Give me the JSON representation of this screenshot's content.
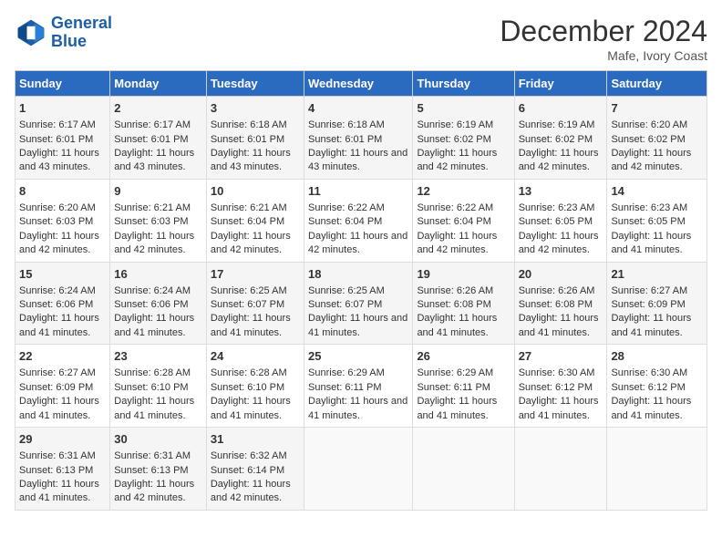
{
  "header": {
    "logo_line1": "General",
    "logo_line2": "Blue",
    "title": "December 2024",
    "subtitle": "Mafe, Ivory Coast"
  },
  "days_of_week": [
    "Sunday",
    "Monday",
    "Tuesday",
    "Wednesday",
    "Thursday",
    "Friday",
    "Saturday"
  ],
  "weeks": [
    [
      {
        "day": "1",
        "sunrise": "6:17 AM",
        "sunset": "6:01 PM",
        "daylight": "11 hours and 43 minutes."
      },
      {
        "day": "2",
        "sunrise": "6:17 AM",
        "sunset": "6:01 PM",
        "daylight": "11 hours and 43 minutes."
      },
      {
        "day": "3",
        "sunrise": "6:18 AM",
        "sunset": "6:01 PM",
        "daylight": "11 hours and 43 minutes."
      },
      {
        "day": "4",
        "sunrise": "6:18 AM",
        "sunset": "6:01 PM",
        "daylight": "11 hours and 43 minutes."
      },
      {
        "day": "5",
        "sunrise": "6:19 AM",
        "sunset": "6:02 PM",
        "daylight": "11 hours and 42 minutes."
      },
      {
        "day": "6",
        "sunrise": "6:19 AM",
        "sunset": "6:02 PM",
        "daylight": "11 hours and 42 minutes."
      },
      {
        "day": "7",
        "sunrise": "6:20 AM",
        "sunset": "6:02 PM",
        "daylight": "11 hours and 42 minutes."
      }
    ],
    [
      {
        "day": "8",
        "sunrise": "6:20 AM",
        "sunset": "6:03 PM",
        "daylight": "11 hours and 42 minutes."
      },
      {
        "day": "9",
        "sunrise": "6:21 AM",
        "sunset": "6:03 PM",
        "daylight": "11 hours and 42 minutes."
      },
      {
        "day": "10",
        "sunrise": "6:21 AM",
        "sunset": "6:04 PM",
        "daylight": "11 hours and 42 minutes."
      },
      {
        "day": "11",
        "sunrise": "6:22 AM",
        "sunset": "6:04 PM",
        "daylight": "11 hours and 42 minutes."
      },
      {
        "day": "12",
        "sunrise": "6:22 AM",
        "sunset": "6:04 PM",
        "daylight": "11 hours and 42 minutes."
      },
      {
        "day": "13",
        "sunrise": "6:23 AM",
        "sunset": "6:05 PM",
        "daylight": "11 hours and 42 minutes."
      },
      {
        "day": "14",
        "sunrise": "6:23 AM",
        "sunset": "6:05 PM",
        "daylight": "11 hours and 41 minutes."
      }
    ],
    [
      {
        "day": "15",
        "sunrise": "6:24 AM",
        "sunset": "6:06 PM",
        "daylight": "11 hours and 41 minutes."
      },
      {
        "day": "16",
        "sunrise": "6:24 AM",
        "sunset": "6:06 PM",
        "daylight": "11 hours and 41 minutes."
      },
      {
        "day": "17",
        "sunrise": "6:25 AM",
        "sunset": "6:07 PM",
        "daylight": "11 hours and 41 minutes."
      },
      {
        "day": "18",
        "sunrise": "6:25 AM",
        "sunset": "6:07 PM",
        "daylight": "11 hours and 41 minutes."
      },
      {
        "day": "19",
        "sunrise": "6:26 AM",
        "sunset": "6:08 PM",
        "daylight": "11 hours and 41 minutes."
      },
      {
        "day": "20",
        "sunrise": "6:26 AM",
        "sunset": "6:08 PM",
        "daylight": "11 hours and 41 minutes."
      },
      {
        "day": "21",
        "sunrise": "6:27 AM",
        "sunset": "6:09 PM",
        "daylight": "11 hours and 41 minutes."
      }
    ],
    [
      {
        "day": "22",
        "sunrise": "6:27 AM",
        "sunset": "6:09 PM",
        "daylight": "11 hours and 41 minutes."
      },
      {
        "day": "23",
        "sunrise": "6:28 AM",
        "sunset": "6:10 PM",
        "daylight": "11 hours and 41 minutes."
      },
      {
        "day": "24",
        "sunrise": "6:28 AM",
        "sunset": "6:10 PM",
        "daylight": "11 hours and 41 minutes."
      },
      {
        "day": "25",
        "sunrise": "6:29 AM",
        "sunset": "6:11 PM",
        "daylight": "11 hours and 41 minutes."
      },
      {
        "day": "26",
        "sunrise": "6:29 AM",
        "sunset": "6:11 PM",
        "daylight": "11 hours and 41 minutes."
      },
      {
        "day": "27",
        "sunrise": "6:30 AM",
        "sunset": "6:12 PM",
        "daylight": "11 hours and 41 minutes."
      },
      {
        "day": "28",
        "sunrise": "6:30 AM",
        "sunset": "6:12 PM",
        "daylight": "11 hours and 41 minutes."
      }
    ],
    [
      {
        "day": "29",
        "sunrise": "6:31 AM",
        "sunset": "6:13 PM",
        "daylight": "11 hours and 41 minutes."
      },
      {
        "day": "30",
        "sunrise": "6:31 AM",
        "sunset": "6:13 PM",
        "daylight": "11 hours and 42 minutes."
      },
      {
        "day": "31",
        "sunrise": "6:32 AM",
        "sunset": "6:14 PM",
        "daylight": "11 hours and 42 minutes."
      },
      null,
      null,
      null,
      null
    ]
  ]
}
